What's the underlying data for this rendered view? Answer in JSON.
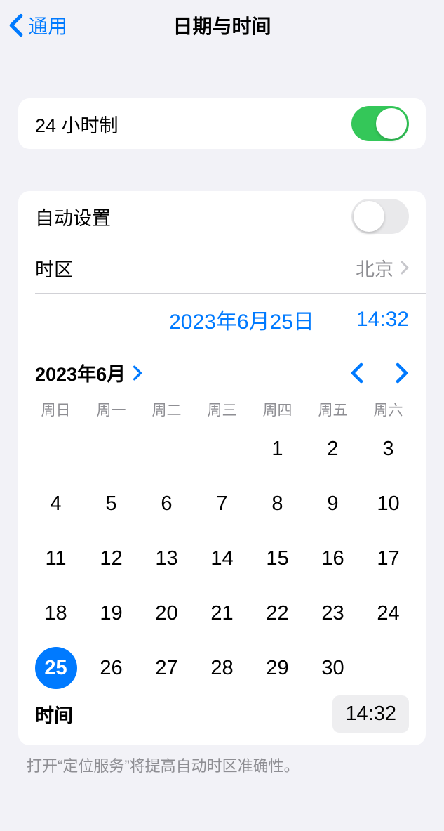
{
  "header": {
    "back_label": "通用",
    "title": "日期与时间"
  },
  "twenty_four_hour": {
    "label": "24 小时制",
    "on": true
  },
  "auto_set": {
    "label": "自动设置",
    "on": false
  },
  "timezone": {
    "label": "时区",
    "value": "北京"
  },
  "datetime": {
    "date_display": "2023年6月25日",
    "time_display": "14:32"
  },
  "calendar": {
    "month_label": "2023年6月",
    "weekdays": [
      "周日",
      "周一",
      "周二",
      "周三",
      "周四",
      "周五",
      "周六"
    ],
    "first_weekday_index": 4,
    "days_in_month": 30,
    "selected_day": 25
  },
  "time_row": {
    "label": "时间",
    "value": "14:32"
  },
  "footnote": "打开“定位服务”将提高自动时区准确性。"
}
